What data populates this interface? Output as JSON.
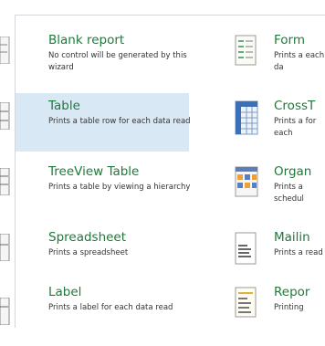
{
  "left_items": [
    {
      "title": "Blank report",
      "desc": "No control will be generated by this wizard",
      "selected": false
    },
    {
      "title": "Table",
      "desc": "Prints a table row for each data read",
      "selected": true
    },
    {
      "title": "TreeView Table",
      "desc": "Prints a table by viewing a hierarchy",
      "selected": false
    },
    {
      "title": "Spreadsheet",
      "desc": "Prints a spreadsheet",
      "selected": false
    },
    {
      "title": "Label",
      "desc": "Prints a label for each data read",
      "selected": false
    }
  ],
  "right_items": [
    {
      "title": "Form",
      "desc": "Prints a each da"
    },
    {
      "title": "CrossT",
      "desc": "Prints a for each"
    },
    {
      "title": "Organ",
      "desc": "Prints a schedul"
    },
    {
      "title": "Mailin",
      "desc": "Prints a read"
    },
    {
      "title": "Repor",
      "desc": "Printing"
    }
  ],
  "icons": {
    "form": "form-icon",
    "crosstab": "crosstab-icon",
    "organizer": "organizer-icon",
    "mailing": "mailing-icon",
    "report": "report-icon"
  },
  "colors": {
    "title_green": "#1e7a3a",
    "selection": "#d9e8f5"
  }
}
